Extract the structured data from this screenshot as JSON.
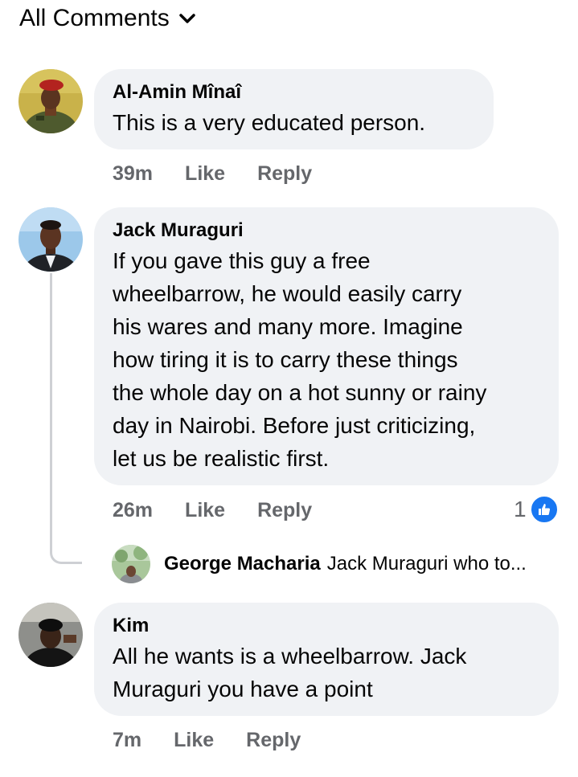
{
  "header": {
    "filter_label": "All Comments",
    "filter_icon": "chevron-down-icon"
  },
  "comments": [
    {
      "author": "Al-Amin Mînaî",
      "text_lines": [
        "This is a very educated person."
      ],
      "time": "39m",
      "like_label": "Like",
      "reply_label": "Reply"
    },
    {
      "author": "Jack Muraguri",
      "text_lines": [
        "If you gave this guy a free",
        "wheelbarrow, he would easily carry",
        "his wares and many more. Imagine",
        "how tiring it is to carry these things",
        "the whole day on a hot sunny or rainy",
        "day in Nairobi. Before just criticizing,",
        "let us be realistic first."
      ],
      "time": "26m",
      "like_label": "Like",
      "reply_label": "Reply",
      "reaction_count": "1",
      "reaction_icon": "like-thumb-icon",
      "reply_preview": {
        "author": "George Macharia",
        "text": "Jack Muraguri who to..."
      }
    },
    {
      "author": "Kim",
      "text_lines": [
        "All he wants is a wheelbarrow. Jack",
        "Muraguri you have a point"
      ],
      "time": "7m",
      "like_label": "Like",
      "reply_label": "Reply"
    }
  ],
  "colors": {
    "bubble": "#f0f2f5",
    "meta_text": "#65676b",
    "like_blue": "#1877f2",
    "thread_line": "#ced0d4"
  }
}
